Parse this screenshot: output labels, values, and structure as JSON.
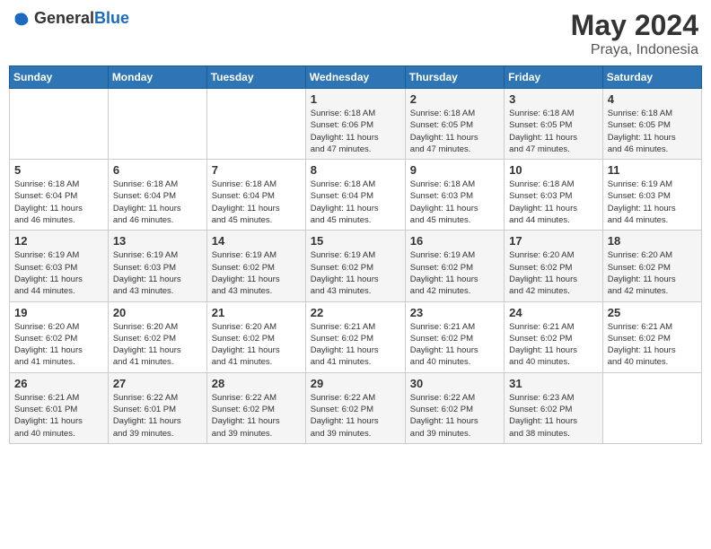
{
  "header": {
    "logo_general": "General",
    "logo_blue": "Blue",
    "month_year": "May 2024",
    "location": "Praya, Indonesia"
  },
  "days_of_week": [
    "Sunday",
    "Monday",
    "Tuesday",
    "Wednesday",
    "Thursday",
    "Friday",
    "Saturday"
  ],
  "weeks": [
    [
      {
        "day": "",
        "info": ""
      },
      {
        "day": "",
        "info": ""
      },
      {
        "day": "",
        "info": ""
      },
      {
        "day": "1",
        "info": "Sunrise: 6:18 AM\nSunset: 6:06 PM\nDaylight: 11 hours\nand 47 minutes."
      },
      {
        "day": "2",
        "info": "Sunrise: 6:18 AM\nSunset: 6:05 PM\nDaylight: 11 hours\nand 47 minutes."
      },
      {
        "day": "3",
        "info": "Sunrise: 6:18 AM\nSunset: 6:05 PM\nDaylight: 11 hours\nand 47 minutes."
      },
      {
        "day": "4",
        "info": "Sunrise: 6:18 AM\nSunset: 6:05 PM\nDaylight: 11 hours\nand 46 minutes."
      }
    ],
    [
      {
        "day": "5",
        "info": "Sunrise: 6:18 AM\nSunset: 6:04 PM\nDaylight: 11 hours\nand 46 minutes."
      },
      {
        "day": "6",
        "info": "Sunrise: 6:18 AM\nSunset: 6:04 PM\nDaylight: 11 hours\nand 46 minutes."
      },
      {
        "day": "7",
        "info": "Sunrise: 6:18 AM\nSunset: 6:04 PM\nDaylight: 11 hours\nand 45 minutes."
      },
      {
        "day": "8",
        "info": "Sunrise: 6:18 AM\nSunset: 6:04 PM\nDaylight: 11 hours\nand 45 minutes."
      },
      {
        "day": "9",
        "info": "Sunrise: 6:18 AM\nSunset: 6:03 PM\nDaylight: 11 hours\nand 45 minutes."
      },
      {
        "day": "10",
        "info": "Sunrise: 6:18 AM\nSunset: 6:03 PM\nDaylight: 11 hours\nand 44 minutes."
      },
      {
        "day": "11",
        "info": "Sunrise: 6:19 AM\nSunset: 6:03 PM\nDaylight: 11 hours\nand 44 minutes."
      }
    ],
    [
      {
        "day": "12",
        "info": "Sunrise: 6:19 AM\nSunset: 6:03 PM\nDaylight: 11 hours\nand 44 minutes."
      },
      {
        "day": "13",
        "info": "Sunrise: 6:19 AM\nSunset: 6:03 PM\nDaylight: 11 hours\nand 43 minutes."
      },
      {
        "day": "14",
        "info": "Sunrise: 6:19 AM\nSunset: 6:02 PM\nDaylight: 11 hours\nand 43 minutes."
      },
      {
        "day": "15",
        "info": "Sunrise: 6:19 AM\nSunset: 6:02 PM\nDaylight: 11 hours\nand 43 minutes."
      },
      {
        "day": "16",
        "info": "Sunrise: 6:19 AM\nSunset: 6:02 PM\nDaylight: 11 hours\nand 42 minutes."
      },
      {
        "day": "17",
        "info": "Sunrise: 6:20 AM\nSunset: 6:02 PM\nDaylight: 11 hours\nand 42 minutes."
      },
      {
        "day": "18",
        "info": "Sunrise: 6:20 AM\nSunset: 6:02 PM\nDaylight: 11 hours\nand 42 minutes."
      }
    ],
    [
      {
        "day": "19",
        "info": "Sunrise: 6:20 AM\nSunset: 6:02 PM\nDaylight: 11 hours\nand 41 minutes."
      },
      {
        "day": "20",
        "info": "Sunrise: 6:20 AM\nSunset: 6:02 PM\nDaylight: 11 hours\nand 41 minutes."
      },
      {
        "day": "21",
        "info": "Sunrise: 6:20 AM\nSunset: 6:02 PM\nDaylight: 11 hours\nand 41 minutes."
      },
      {
        "day": "22",
        "info": "Sunrise: 6:21 AM\nSunset: 6:02 PM\nDaylight: 11 hours\nand 41 minutes."
      },
      {
        "day": "23",
        "info": "Sunrise: 6:21 AM\nSunset: 6:02 PM\nDaylight: 11 hours\nand 40 minutes."
      },
      {
        "day": "24",
        "info": "Sunrise: 6:21 AM\nSunset: 6:02 PM\nDaylight: 11 hours\nand 40 minutes."
      },
      {
        "day": "25",
        "info": "Sunrise: 6:21 AM\nSunset: 6:02 PM\nDaylight: 11 hours\nand 40 minutes."
      }
    ],
    [
      {
        "day": "26",
        "info": "Sunrise: 6:21 AM\nSunset: 6:01 PM\nDaylight: 11 hours\nand 40 minutes."
      },
      {
        "day": "27",
        "info": "Sunrise: 6:22 AM\nSunset: 6:01 PM\nDaylight: 11 hours\nand 39 minutes."
      },
      {
        "day": "28",
        "info": "Sunrise: 6:22 AM\nSunset: 6:02 PM\nDaylight: 11 hours\nand 39 minutes."
      },
      {
        "day": "29",
        "info": "Sunrise: 6:22 AM\nSunset: 6:02 PM\nDaylight: 11 hours\nand 39 minutes."
      },
      {
        "day": "30",
        "info": "Sunrise: 6:22 AM\nSunset: 6:02 PM\nDaylight: 11 hours\nand 39 minutes."
      },
      {
        "day": "31",
        "info": "Sunrise: 6:23 AM\nSunset: 6:02 PM\nDaylight: 11 hours\nand 38 minutes."
      },
      {
        "day": "",
        "info": ""
      }
    ]
  ]
}
